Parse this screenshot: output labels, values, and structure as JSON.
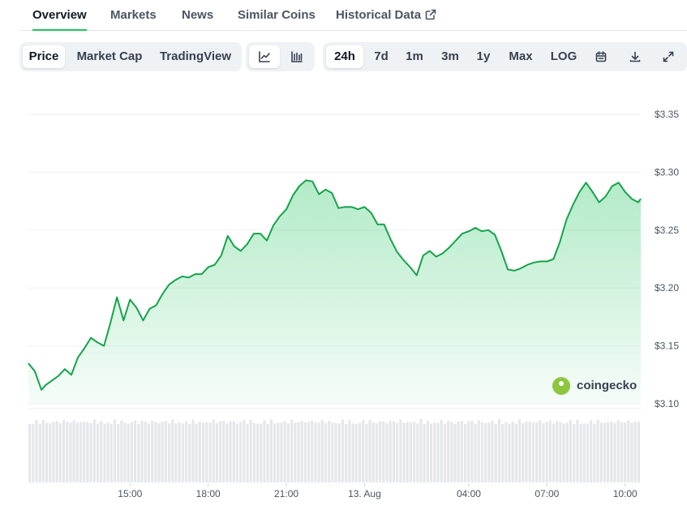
{
  "tabs": [
    {
      "label": "Overview",
      "active": true
    },
    {
      "label": "Markets"
    },
    {
      "label": "News"
    },
    {
      "label": "Similar Coins"
    },
    {
      "label": "Historical Data",
      "icon": "external-link-icon"
    }
  ],
  "toolbar": {
    "chart_types": [
      "Price",
      "Market Cap",
      "TradingView"
    ],
    "chart_type_selected": "Price",
    "view_icons": [
      "line-chart-icon",
      "candlestick-chart-icon"
    ],
    "view_selected": "line-chart-icon",
    "ranges": [
      "24h",
      "7d",
      "1m",
      "3m",
      "1y",
      "Max",
      "LOG"
    ],
    "range_selected": "24h",
    "action_icons": [
      "calendar-icon",
      "download-icon",
      "expand-icon"
    ]
  },
  "brand": {
    "text": "coingecko",
    "icon": "coingecko-logo-icon"
  },
  "colors": {
    "line": "#16a34a",
    "fill": "#22c55e",
    "volume": "#e5e7eb",
    "active_tab": "#22c55e"
  },
  "chart_data": {
    "type": "area",
    "y_ticks": [
      "$3.35",
      "$3.30",
      "$3.25",
      "$3.20",
      "$3.15",
      "$3.10"
    ],
    "x_ticks": [
      "15:00",
      "18:00",
      "21:00",
      "13. Aug",
      "04:00",
      "07:00",
      "10:00"
    ],
    "ylim": [
      3.1,
      3.35
    ],
    "xlim_hours": [
      11.1,
      34.6
    ],
    "grid": true,
    "legend": "none",
    "series": [
      {
        "x_hours": [
          11.1,
          11.35,
          11.6,
          11.75,
          12.0,
          12.25,
          12.5,
          12.75,
          13.0,
          13.25,
          13.5,
          13.75,
          14.0,
          14.25,
          14.5,
          14.75,
          15.0,
          15.25,
          15.5,
          15.75,
          16.0,
          16.25,
          16.5,
          16.75,
          17.0,
          17.25,
          17.5,
          17.75,
          18.0,
          18.25,
          18.5,
          18.75,
          19.0,
          19.25,
          19.5,
          19.75,
          20.0,
          20.25,
          20.5,
          20.75,
          21.0,
          21.25,
          21.5,
          21.75,
          22.0,
          22.25,
          22.5,
          22.75,
          23.0,
          23.25,
          23.5,
          23.75,
          24.0,
          24.25,
          24.5,
          24.75,
          25.0,
          25.25,
          25.5,
          25.75,
          26.0,
          26.25,
          26.5,
          26.75,
          27.0,
          27.25,
          27.5,
          27.75,
          28.0,
          28.25,
          28.5,
          28.75,
          29.0,
          29.25,
          29.5,
          29.75,
          30.0,
          30.25,
          30.5,
          30.75,
          31.0,
          31.25,
          31.5,
          31.75,
          32.0,
          32.25,
          32.5,
          32.75,
          33.0,
          33.25,
          33.5,
          33.75,
          34.0,
          34.25,
          34.5,
          34.6
        ],
        "values": [
          3.135,
          3.128,
          3.112,
          3.116,
          3.12,
          3.124,
          3.13,
          3.125,
          3.14,
          3.148,
          3.157,
          3.153,
          3.15,
          3.17,
          3.192,
          3.172,
          3.19,
          3.183,
          3.172,
          3.182,
          3.185,
          3.195,
          3.203,
          3.207,
          3.21,
          3.209,
          3.212,
          3.212,
          3.218,
          3.22,
          3.228,
          3.245,
          3.236,
          3.232,
          3.238,
          3.247,
          3.247,
          3.241,
          3.254,
          3.262,
          3.268,
          3.28,
          3.288,
          3.293,
          3.292,
          3.281,
          3.285,
          3.282,
          3.269,
          3.27,
          3.27,
          3.268,
          3.27,
          3.265,
          3.255,
          3.255,
          3.242,
          3.231,
          3.224,
          3.218,
          3.211,
          3.228,
          3.232,
          3.227,
          3.23,
          3.235,
          3.241,
          3.247,
          3.249,
          3.252,
          3.249,
          3.25,
          3.246,
          3.232,
          3.216,
          3.215,
          3.217,
          3.22,
          3.222,
          3.223,
          3.223,
          3.225,
          3.24,
          3.259,
          3.272,
          3.283,
          3.291,
          3.283,
          3.274,
          3.279,
          3.288,
          3.291,
          3.283,
          3.277,
          3.274,
          3.277
        ]
      }
    ],
    "volume_bars": 180
  }
}
